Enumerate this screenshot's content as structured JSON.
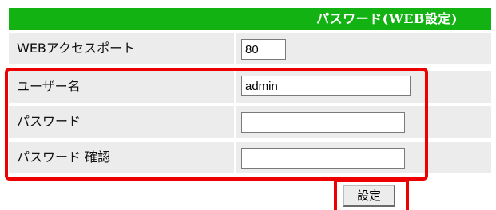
{
  "header": {
    "title": "パスワード(WEB設定)"
  },
  "rows": [
    {
      "label": "WEBアクセスポート",
      "value": "80"
    },
    {
      "label": "ユーザー名",
      "value": "admin"
    },
    {
      "label": "パスワード",
      "value": ""
    },
    {
      "label": "パスワード 確認",
      "value": ""
    }
  ],
  "submit": {
    "label": "設定"
  },
  "colors": {
    "header_bg": "#11b211",
    "highlight": "#ee0000",
    "cell_bg": "#ececec"
  }
}
